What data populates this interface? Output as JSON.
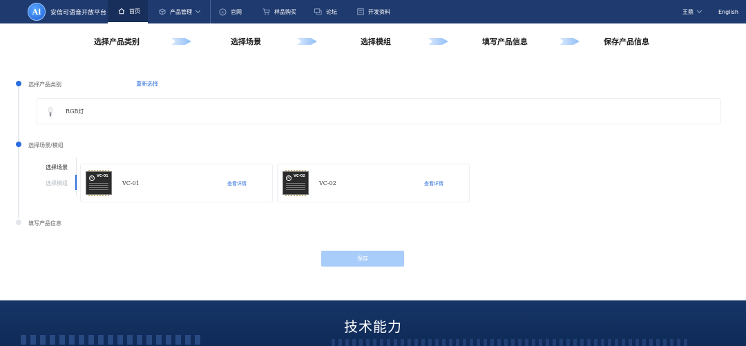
{
  "nav": {
    "brand": "安信可语音开放平台",
    "items": [
      {
        "label": "首页",
        "icon": "home-icon"
      },
      {
        "label": "产品管理",
        "icon": "cube-icon"
      },
      {
        "label": "官网",
        "icon": "ai-logo-icon"
      },
      {
        "label": "样品购买",
        "icon": "cart-icon"
      },
      {
        "label": "论坛",
        "icon": "chat-icon"
      },
      {
        "label": "开发资料",
        "icon": "document-icon"
      }
    ],
    "user": "王鼎",
    "language": "English"
  },
  "steps": [
    "选择产品类别",
    "选择场景",
    "选择模组",
    "填写产品信息",
    "保存产品信息"
  ],
  "sections": {
    "category_label": "选择产品类别",
    "reselect": "重新选择",
    "category_name": "RGB灯",
    "scene_module_label": "选择场景/模组",
    "fill_info_label": "填写产品信息"
  },
  "subtabs": {
    "scene": "选择场景",
    "module": "选择模组"
  },
  "modules": [
    {
      "chip_text": "VC-01",
      "name": "VC-01",
      "link": "查看详情"
    },
    {
      "chip_text": "VC-02",
      "name": "VC-02",
      "link": "查看详情"
    }
  ],
  "save_button": "保存",
  "banner_title": "技术能力",
  "colors": {
    "nav_bg": "#1f3a6e",
    "accent": "#2a6dde",
    "save_button": "#a9cdfa",
    "banner_bg": "#163567"
  }
}
